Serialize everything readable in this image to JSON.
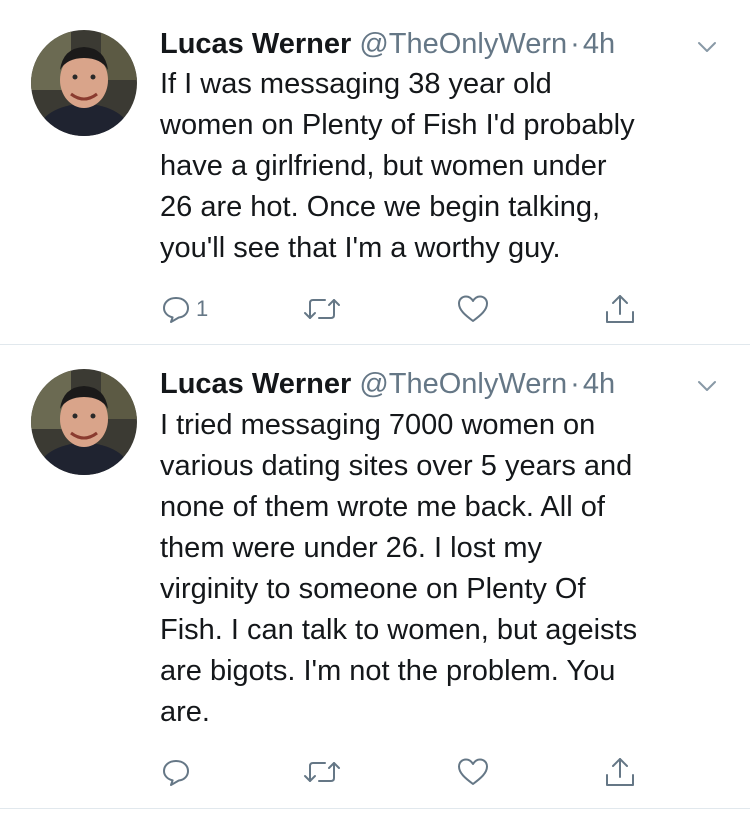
{
  "tweets": [
    {
      "author": {
        "name": "Lucas Werner",
        "handle": "@TheOnlyWern",
        "avatar_icon": "profile-photo"
      },
      "separator": "·",
      "time": "4h",
      "lines": [
        "If I was messaging 38 year old",
        "women on Plenty of Fish I'd probably",
        "have a girlfriend, but women under",
        "26 are hot. Once we begin talking,",
        "you'll see that I'm a worthy guy."
      ],
      "actions": {
        "reply_count": "1",
        "retweet_count": "",
        "like_count": ""
      }
    },
    {
      "author": {
        "name": "Lucas Werner",
        "handle": "@TheOnlyWern",
        "avatar_icon": "profile-photo"
      },
      "separator": "·",
      "time": "4h",
      "lines": [
        "I tried messaging 7000 women on",
        "various dating sites over 5 years and",
        "none of them wrote me back. All of",
        "them were under 26. I lost my",
        "virginity to someone on Plenty Of",
        "Fish. I can talk to women, but ageists",
        "are bigots. I'm not the problem. You",
        "are."
      ],
      "actions": {
        "reply_count": "",
        "retweet_count": "",
        "like_count": ""
      }
    }
  ],
  "colors": {
    "text": "#14171a",
    "secondary": "#657786",
    "divider": "#e1e8ed"
  }
}
